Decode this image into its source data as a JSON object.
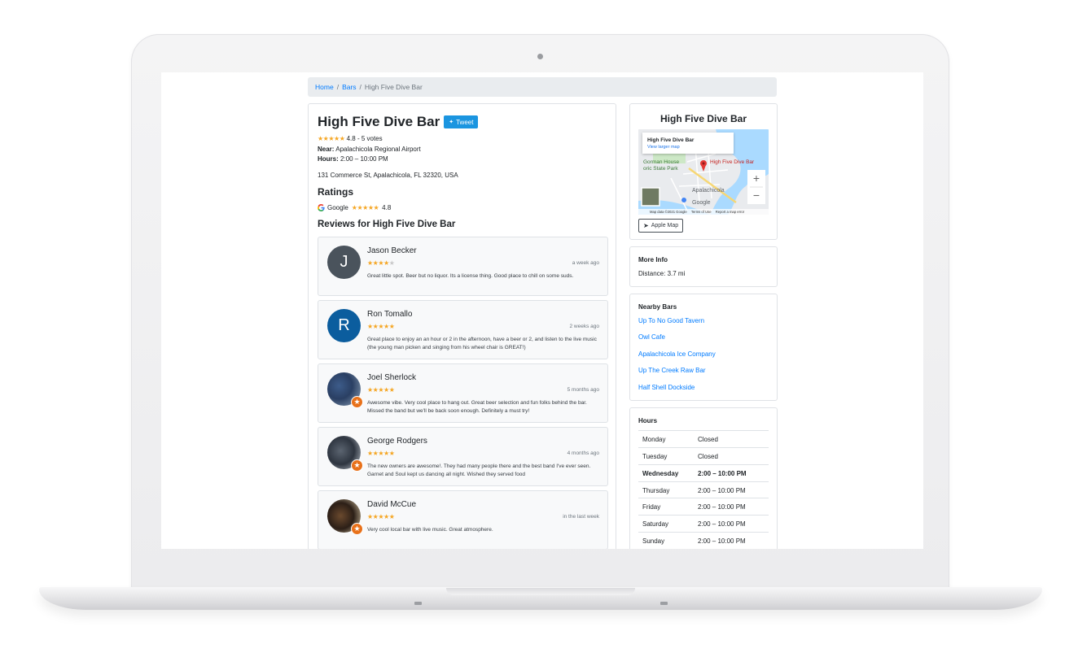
{
  "breadcrumb": {
    "home": "Home",
    "bars": "Bars",
    "current": "High Five Dive Bar"
  },
  "bar": {
    "name": "High Five Dive Bar",
    "tweet_label": "Tweet",
    "rating_text": "4.8 - 5 votes",
    "near_label": "Near:",
    "near_value": "Apalachicola Regional Airport",
    "hours_label": "Hours:",
    "hours_value": "2:00 – 10:00 PM",
    "address": "131 Commerce St, Apalachicola, FL 32320, USA"
  },
  "ratings": {
    "heading": "Ratings",
    "source": "Google",
    "value": "4.8"
  },
  "reviews_heading": "Reviews for High Five Dive Bar",
  "reviews": [
    {
      "name": "Jason Becker",
      "initial": "J",
      "avatar_color": "#4a535c",
      "stars": 4,
      "time": "a week ago",
      "text": "Great little spot. Beer but no liquor. Its a license thing. Good place to chill on some suds."
    },
    {
      "name": "Ron Tomallo",
      "initial": "R",
      "avatar_color": "#0b5d9e",
      "stars": 5,
      "time": "2 weeks ago",
      "text": "Great place to enjoy an an hour or 2 in the afternoon, have a beer or 2, and listen to the live music (the young man picken and singing from his wheel chair is GREAT!)"
    },
    {
      "name": "Joel Sherlock",
      "initial": "",
      "avatar_color": "",
      "stars": 5,
      "time": "5 months ago",
      "text": "Awesome vibe. Very cool place to hang out. Great beer selection and fun folks behind the bar. Missed the band but we'll be back soon enough. Definitely a must try!"
    },
    {
      "name": "George Rodgers",
      "initial": "",
      "avatar_color": "",
      "stars": 5,
      "time": "4 months ago",
      "text": "The new owners are awesome!. They had many people there and the best band I've ever seen. Garnet and Soul kept us dancing all night. Wished they served food"
    },
    {
      "name": "David McCue",
      "initial": "",
      "avatar_color": "",
      "stars": 5,
      "time": "in the last week",
      "text": "Very cool local bar with live music. Great atmosphere."
    }
  ],
  "map_card": {
    "title": "High Five Dive Bar",
    "popup_title": "High Five Dive Bar",
    "popup_link": "View larger map",
    "marker_label": "High Five Dive Bar",
    "label_park_1": "Gorman House",
    "label_park_2": "oric State Park",
    "label_city": "Apalachicola",
    "zoom_in": "+",
    "zoom_out": "−",
    "google": "Google",
    "footer_data": "Map data ©2021 Google",
    "footer_terms": "Terms of Use",
    "footer_report": "Report a map error",
    "apple_button": "Apple Map"
  },
  "more_info": {
    "title": "More Info",
    "distance": "Distance: 3.7 mi"
  },
  "nearby": {
    "title": "Nearby Bars",
    "items": [
      "Up To No Good Tavern",
      "Owl Cafe",
      "Apalachicola Ice Company",
      "Up The Creek Raw Bar",
      "Half Shell Dockside"
    ]
  },
  "hours": {
    "title": "Hours",
    "rows": [
      {
        "day": "Monday",
        "time": "Closed"
      },
      {
        "day": "Tuesday",
        "time": "Closed"
      },
      {
        "day": "Wednesday",
        "time": "2:00 – 10:00 PM"
      },
      {
        "day": "Thursday",
        "time": "2:00 – 10:00 PM"
      },
      {
        "day": "Friday",
        "time": "2:00 – 10:00 PM"
      },
      {
        "day": "Saturday",
        "time": "2:00 – 10:00 PM"
      },
      {
        "day": "Sunday",
        "time": "2:00 – 10:00 PM"
      }
    ]
  },
  "colors": {
    "link": "#007bff",
    "star": "#f5a623",
    "tweet": "#1b95e0",
    "map_marker": "#e53935"
  }
}
